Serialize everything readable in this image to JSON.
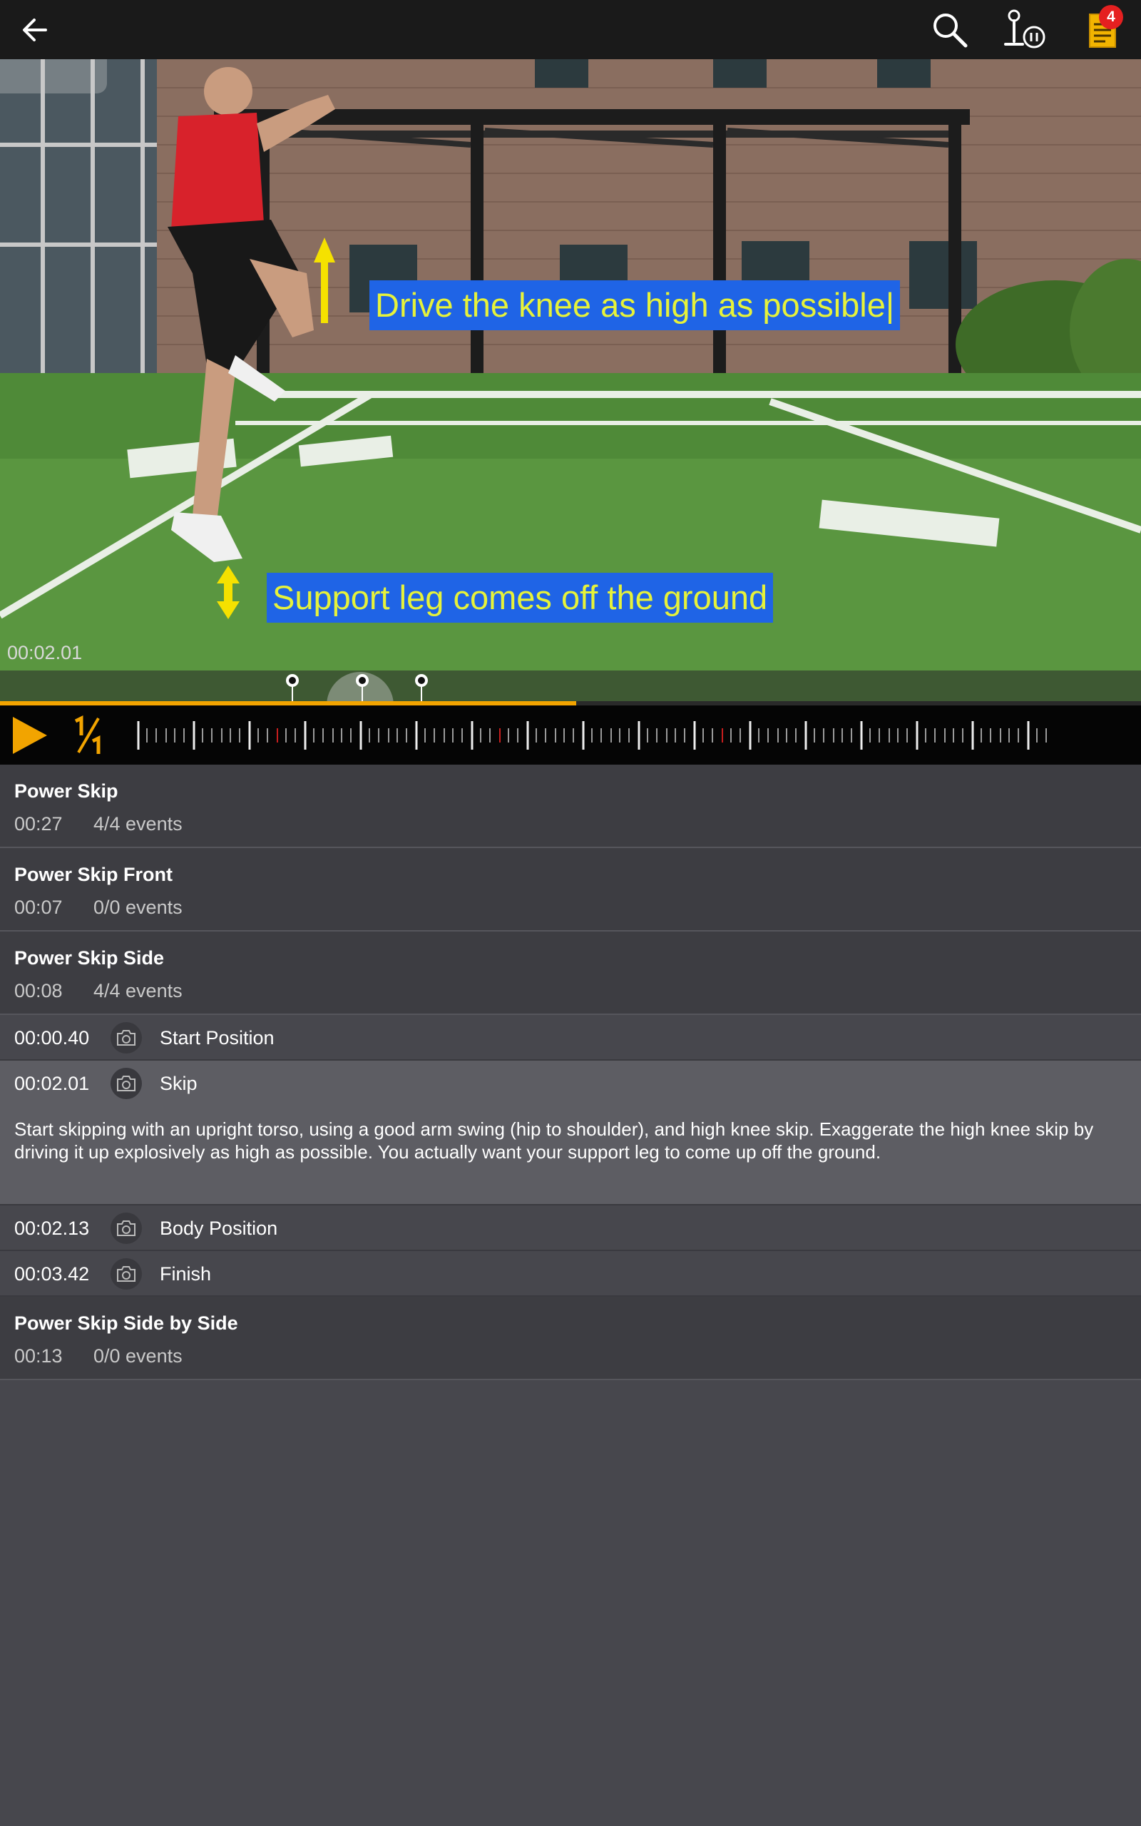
{
  "topbar": {
    "notification_count": "4"
  },
  "video": {
    "caption_top": "Drive the knee as high as possible|",
    "caption_bottom": "Support leg comes off the ground",
    "timestamp": "00:02.01",
    "progress_fraction": 0.505
  },
  "controls": {
    "accent_color": "#f2a400"
  },
  "clips": [
    {
      "title": "Power Skip",
      "duration": "00:27",
      "events": "4/4 events"
    },
    {
      "title": "Power Skip Front",
      "duration": "00:07",
      "events": "0/0 events"
    },
    {
      "title": "Power Skip Side",
      "duration": "00:08",
      "events": "4/4 events"
    },
    {
      "title": "Power Skip Side by Side",
      "duration": "00:13",
      "events": "0/0 events"
    }
  ],
  "events": [
    {
      "time": "00:00.40",
      "label": "Start Position"
    },
    {
      "time": "00:02.01",
      "label": "Skip",
      "description": "Start skipping with an upright torso, using a good arm swing (hip to shoulder), and high knee skip.  Exaggerate the high knee skip by driving it up explosively as high as possible. You actually want your support leg to come up off the ground."
    },
    {
      "time": "00:02.13",
      "label": "Body Position"
    },
    {
      "time": "00:03.42",
      "label": "Finish"
    }
  ]
}
